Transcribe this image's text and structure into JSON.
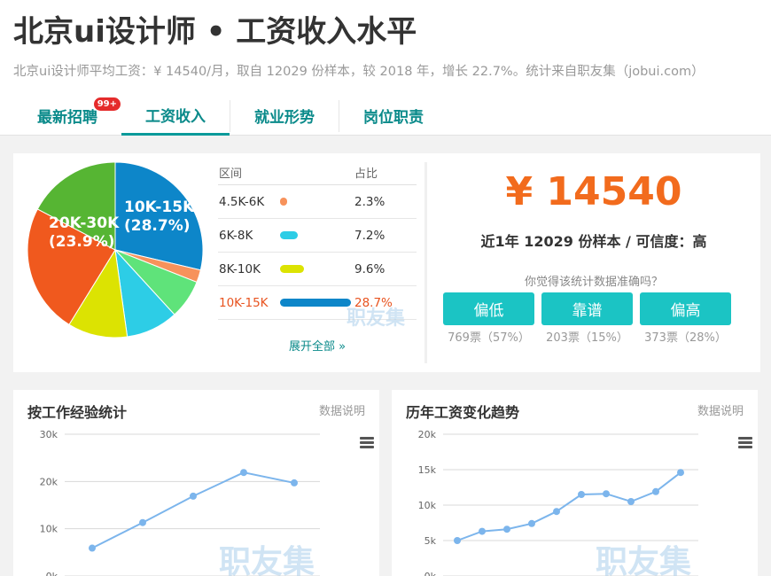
{
  "header": {
    "title": "北京ui设计师 • 工资收入水平",
    "subtitle": "北京ui设计师平均工资：¥ 14540/月，取自 12029 份样本，较 2018 年，增长 22.7%。统计来自职友集（jobui.com）",
    "tabs": [
      {
        "label": "最新招聘",
        "badge": "99+"
      },
      {
        "label": "工资收入"
      },
      {
        "label": "就业形势"
      },
      {
        "label": "岗位职责"
      }
    ]
  },
  "pie": {
    "labels": [
      {
        "range": "10K-15K",
        "pct": "(28.7%)"
      },
      {
        "range": "20K-30K",
        "pct": "(23.9%)"
      }
    ],
    "slices": [
      {
        "value": 28.7,
        "color": "#0d86c9"
      },
      {
        "value": 2.3,
        "color": "#f7925b"
      },
      {
        "value": 7.2,
        "color": "#5fe37a"
      },
      {
        "value": 9.6,
        "color": "#2dcde6"
      },
      {
        "value": 11.0,
        "color": "#dce302"
      },
      {
        "value": 23.9,
        "color": "#f0591e"
      },
      {
        "value": 17.3,
        "color": "#56b533"
      }
    ]
  },
  "distribution": {
    "col_range": "区间",
    "col_pct": "占比",
    "rows": [
      {
        "range": "4.5K-6K",
        "pct": "2.3%",
        "value": 2.3,
        "color": "#f7925b",
        "highlight": false
      },
      {
        "range": "6K-8K",
        "pct": "7.2%",
        "value": 7.2,
        "color": "#2dcde6",
        "highlight": false
      },
      {
        "range": "8K-10K",
        "pct": "9.6%",
        "value": 9.6,
        "color": "#dce302",
        "highlight": false
      },
      {
        "range": "10K-15K",
        "pct": "28.7%",
        "value": 28.7,
        "color": "#0d86c9",
        "highlight": true
      }
    ],
    "expand": "展开全部 »",
    "watermark": "职友集"
  },
  "summary": {
    "salary": "¥ 14540",
    "sample": "近1年 12029 份样本 / 可信度：高",
    "question": "你觉得该统计数据准确吗？",
    "votes": [
      {
        "label": "偏低",
        "count": "769票（57%）"
      },
      {
        "label": "靠谱",
        "count": "203票（15%）"
      },
      {
        "label": "偏高",
        "count": "373票（28%）"
      }
    ]
  },
  "charts": {
    "note_label": "数据说明",
    "watermark": "职友集"
  },
  "chart_data": [
    {
      "type": "line",
      "title": "按工作经验统计",
      "yticks": [
        "30k",
        "20k",
        "10k",
        "0k"
      ],
      "ylim": [
        0,
        30000
      ],
      "x": [
        1,
        2,
        3,
        4,
        5
      ],
      "values": [
        5900,
        11300,
        16900,
        21900,
        19700
      ],
      "color": "#7cb5ec"
    },
    {
      "type": "line",
      "title": "历年工资变化趋势",
      "yticks": [
        "20k",
        "15k",
        "10k",
        "5k",
        "0k"
      ],
      "ylim": [
        0,
        20000
      ],
      "x": [
        1,
        2,
        3,
        4,
        5,
        6,
        7,
        8,
        9,
        10,
        11
      ],
      "values": [
        5000,
        6300,
        6600,
        7400,
        9100,
        11500,
        11600,
        10500,
        11900,
        14600
      ],
      "color": "#7cb5ec"
    }
  ]
}
